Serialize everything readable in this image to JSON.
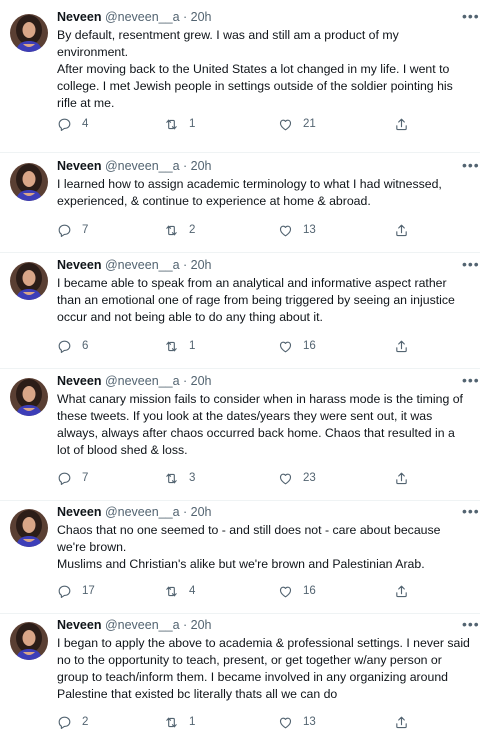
{
  "colors": {
    "text": "#0f1419",
    "secondary": "#536471",
    "divider": "#eff3f4"
  },
  "tweets": [
    {
      "name": "Neveen",
      "meta": "@neveen__a · 20h",
      "lines": [
        "By default, resentment grew. I was and still am a product of my",
        "environment.",
        "After moving back to the United States a lot changed in my life. I went to",
        "college. I met Jewish people in settings outside of the soldier pointing his",
        "rifle at me."
      ],
      "replies": "4",
      "retweets": "1",
      "likes": "21"
    },
    {
      "name": "Neveen",
      "meta": "@neveen__a · 20h",
      "lines": [
        "I learned how to assign academic terminology to what I had witnessed,",
        "experienced, & continue to experience at home & abroad."
      ],
      "replies": "7",
      "retweets": "2",
      "likes": "13"
    },
    {
      "name": "Neveen",
      "meta": "@neveen__a · 20h",
      "lines": [
        "I became able to speak from an analytical and informative aspect rather",
        "than an emotional one of rage from being triggered by seeing an injustice",
        "occur and not being able to do any thing about it."
      ],
      "replies": "6",
      "retweets": "1",
      "likes": "16"
    },
    {
      "name": "Neveen",
      "meta": "@neveen__a · 20h",
      "lines": [
        "What canary mission fails to consider when in harass mode is the timing of",
        "these tweets. If you look at the dates/years they were sent out, it was",
        "always, always after chaos occurred back home. Chaos that resulted in a",
        "lot of blood shed & loss."
      ],
      "replies": "7",
      "retweets": "3",
      "likes": "23"
    },
    {
      "name": "Neveen",
      "meta": "@neveen__a · 20h",
      "lines": [
        "Chaos that no one seemed to - and still does not - care about because",
        "we're brown.",
        "Muslims and Christian's alike but we're brown and Palestinian Arab."
      ],
      "replies": "17",
      "retweets": "4",
      "likes": "16"
    },
    {
      "name": "Neveen",
      "meta": "@neveen__a · 20h",
      "lines": [
        "I began to apply the above to academia & professional settings. I never said",
        "no to the opportunity to teach, present, or get together w/any person or",
        "group to teach/inform them. I became involved in any organizing around",
        "Palestine that existed bc literally thats all we can do"
      ],
      "replies": "2",
      "retweets": "1",
      "likes": "13"
    }
  ],
  "icons": {
    "reply": "reply-icon",
    "retweet": "retweet-icon",
    "like": "heart-icon",
    "share": "share-icon",
    "more": "more-icon"
  }
}
